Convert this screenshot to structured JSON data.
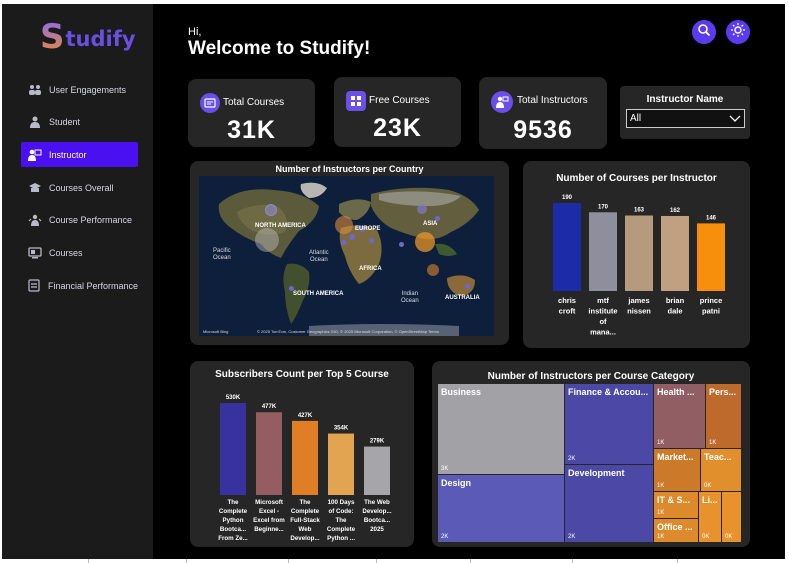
{
  "app": {
    "logo_first": "S",
    "logo_rest": "tudify"
  },
  "sidebar": {
    "items": [
      {
        "label": "User Engagements",
        "icon": "users-icon"
      },
      {
        "label": "Student",
        "icon": "student-icon"
      },
      {
        "label": "Instructor",
        "icon": "instructor-icon",
        "active": true
      },
      {
        "label": "Courses Overall",
        "icon": "graduation-cap-icon"
      },
      {
        "label": "Course Performance",
        "icon": "performance-icon"
      },
      {
        "label": "Courses",
        "icon": "courses-icon"
      },
      {
        "label": "Financial Performance",
        "icon": "finance-icon"
      }
    ]
  },
  "header": {
    "hi": "Hi,",
    "title": "Welcome to Studify!"
  },
  "kpis": [
    {
      "label": "Total Courses",
      "value": "31K",
      "icon": "book-icon"
    },
    {
      "label": "Free Courses",
      "value": "23K",
      "icon": "grid-book-icon"
    },
    {
      "label": "Total Instructors",
      "value": "9536",
      "icon": "instructor-icon"
    }
  ],
  "slicer": {
    "title": "Instructor Name",
    "value": "All"
  },
  "map": {
    "title": "Number of Instructors per Country",
    "continents": [
      "NORTH AMERICA",
      "EUROPE",
      "ASIA",
      "AFRICA",
      "SOUTH AMERICA",
      "AUSTRALIA"
    ],
    "oceans": [
      "Pacific\nOcean",
      "Atlantic\nOcean",
      "Indian\nOcean"
    ],
    "attribution": "© 2025 TomTom, Customer Geographics GIO, © 2025 Microsoft Corporation, © OpenStreetMap  Terms",
    "brand": "Microsoft Bing"
  },
  "chart_data": [
    {
      "type": "bar",
      "title": "Number of Courses per Instructor",
      "categories": [
        "chris croft",
        "mtf institute of mana...",
        "james nissen",
        "brian dale",
        "prince patni"
      ],
      "values": [
        190,
        170,
        163,
        162,
        146
      ],
      "value_labels": [
        "190",
        "170",
        "163",
        "162",
        "146"
      ],
      "colors": [
        "#1c2ca8",
        "#8e8e9c",
        "#b59a7e",
        "#c1a082",
        "#f78e0c"
      ]
    },
    {
      "type": "bar",
      "title": "Subscribers Count per Top 5 Course",
      "categories": [
        "The Complete Python Bootca... From Ze...",
        "Microsoft Excel - Excel from Beginne...",
        "The Complete Full-Stack Web Develop...",
        "100 Days of Code: The Complete Python ...",
        "The Web Develop... Bootca... 2025"
      ],
      "values": [
        530000,
        477000,
        427000,
        354000,
        279000
      ],
      "value_labels": [
        "530K",
        "477K",
        "427K",
        "354K",
        "279K"
      ],
      "colors": [
        "#3732a0",
        "#955c62",
        "#df7e24",
        "#e2a450",
        "#a6a6aa"
      ]
    },
    {
      "type": "treemap",
      "title": "Number of Instructors per Course Category",
      "items": [
        {
          "name": "Business",
          "label": "3K",
          "value": 3,
          "color": "#a2a2a6"
        },
        {
          "name": "Design",
          "label": "2K",
          "value": 2,
          "color": "#5b5ab7"
        },
        {
          "name": "Finance & Accou...",
          "label": "2K",
          "value": 2,
          "color": "#4c49a6"
        },
        {
          "name": "Development",
          "label": "2K",
          "value": 2,
          "color": "#4c49a6"
        },
        {
          "name": "Health ...",
          "label": "1K",
          "value": 1,
          "color": "#915e63"
        },
        {
          "name": "Pers...",
          "label": "1K",
          "value": 1,
          "color": "#bd6a2c"
        },
        {
          "name": "Market...",
          "label": "1K",
          "value": 1,
          "color": "#cc7a2a"
        },
        {
          "name": "Teac...",
          "label": "0K",
          "value": 0.5,
          "color": "#e08f2c"
        },
        {
          "name": "IT & S...",
          "label": "1K",
          "value": 1,
          "color": "#dd8a2c"
        },
        {
          "name": "Office ...",
          "label": "1K",
          "value": 1,
          "color": "#dd8a2c"
        },
        {
          "name": "Li...",
          "label": "0K",
          "value": 0.3,
          "color": "#e8922e"
        },
        {
          "name": "",
          "label": "0K",
          "value": 0.2,
          "color": "#e8922e"
        }
      ]
    }
  ]
}
